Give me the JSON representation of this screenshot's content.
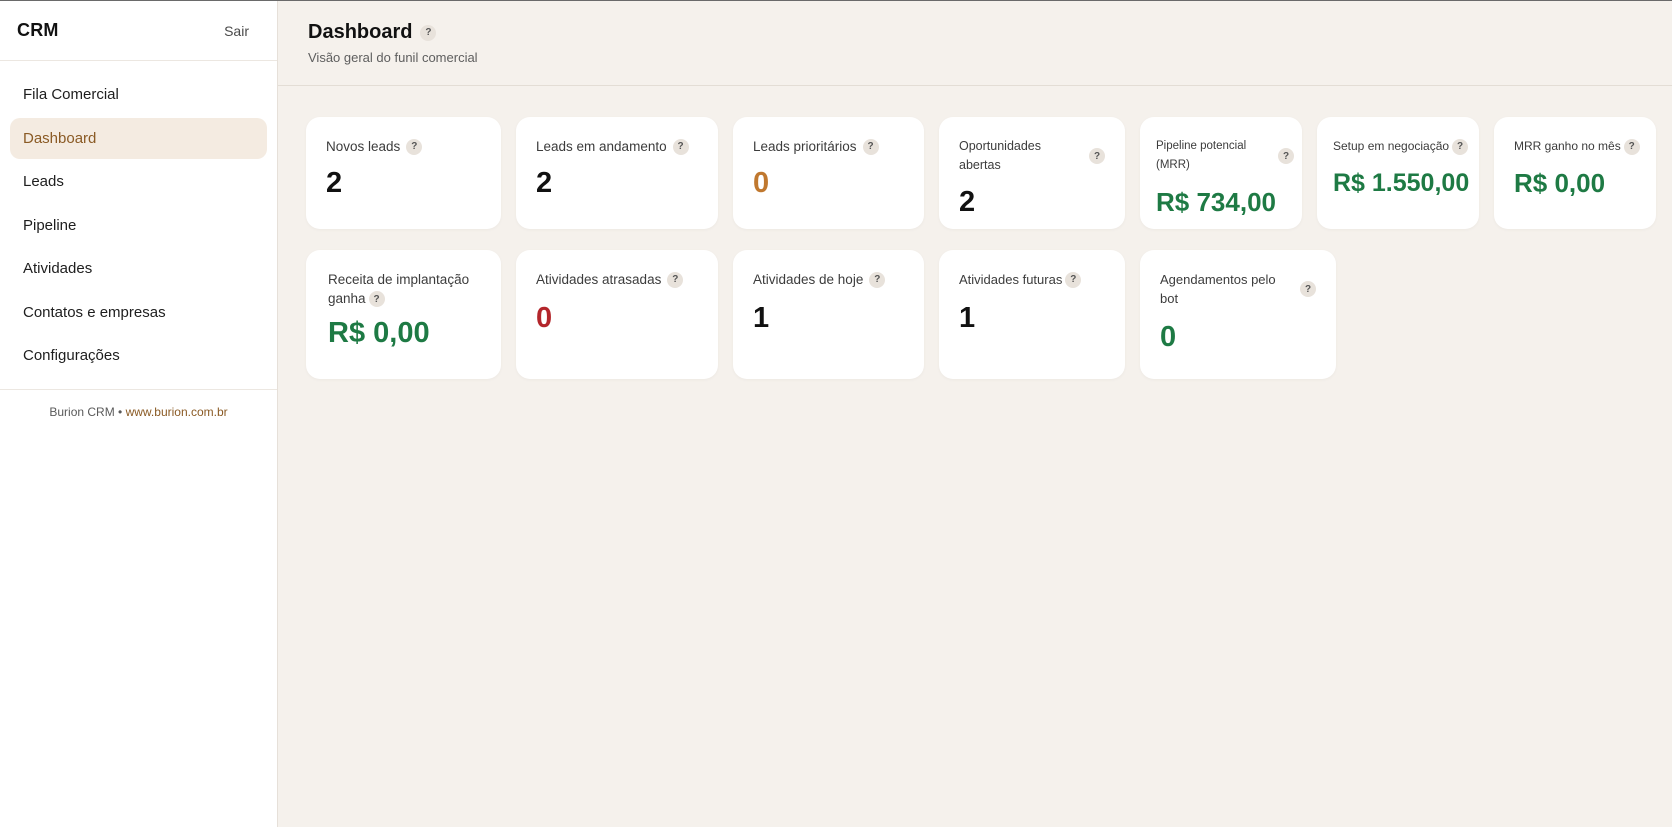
{
  "sidebar": {
    "brand": "CRM",
    "logout": "Sair",
    "items": [
      {
        "label": "Fila Comercial"
      },
      {
        "label": "Dashboard"
      },
      {
        "label": "Leads"
      },
      {
        "label": "Pipeline"
      },
      {
        "label": "Atividades"
      },
      {
        "label": "Contatos e empresas"
      },
      {
        "label": "Configurações"
      }
    ],
    "active_index": 1,
    "footer_text": "Burion CRM •",
    "footer_link": "www.burion.com.br"
  },
  "header": {
    "title": "Dashboard",
    "subtitle": "Visão geral do funil comercial",
    "help": "?"
  },
  "cards": {
    "novos_leads": {
      "label": "Novos leads",
      "value": "2"
    },
    "leads_andamento": {
      "label": "Leads em andamento",
      "value": "2"
    },
    "leads_prioritarios": {
      "label": "Leads prioritários",
      "value": "0"
    },
    "oportunidades_abertas": {
      "label": "Oportunidades abertas",
      "value": "2"
    },
    "pipeline_potencial": {
      "label": "Pipeline potencial (MRR)",
      "value": "R$ 734,00"
    },
    "setup_negociacao": {
      "label": "Setup em negociação",
      "value": "R$ 1.550,00"
    },
    "mrr_ganho": {
      "label": "MRR ganho no mês",
      "value": "R$ 0,00"
    },
    "receita_implantacao": {
      "label": "Receita de implantação ganha",
      "value": "R$ 0,00"
    },
    "atividades_atrasadas": {
      "label": "Atividades atrasadas",
      "value": "0"
    },
    "atividades_hoje": {
      "label": "Atividades de hoje",
      "value": "1"
    },
    "atividades_futuras": {
      "label": "Atividades futuras",
      "value": "1"
    },
    "agendamentos_bot": {
      "label": "Agendamentos pelo bot",
      "value": "0"
    }
  },
  "colors": {
    "accent": "#8a5a24",
    "active_bg": "#f4ebe1",
    "positive": "#1e7a44",
    "warning": "#c0782f",
    "danger": "#b3262b"
  }
}
